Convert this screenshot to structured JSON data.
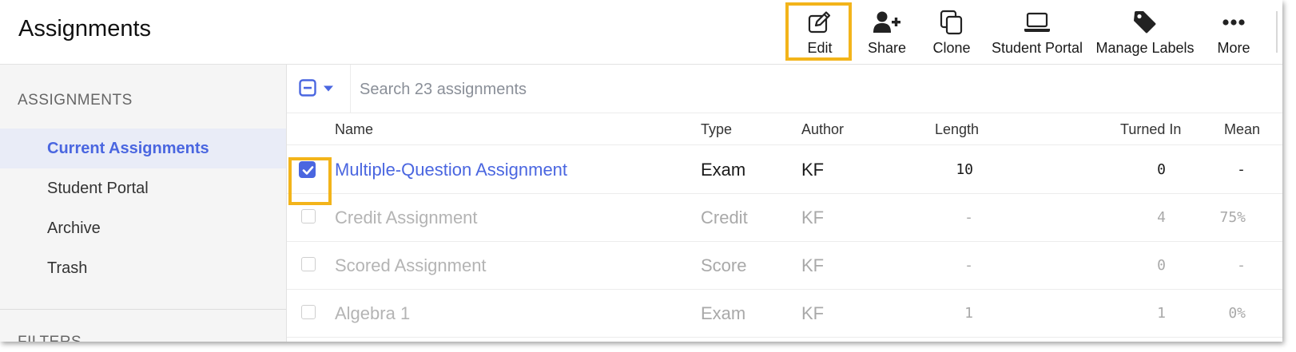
{
  "header": {
    "title": "Assignments",
    "toolbar": [
      {
        "id": "edit",
        "label": "Edit",
        "icon": "edit-icon"
      },
      {
        "id": "share",
        "label": "Share",
        "icon": "user-plus-icon"
      },
      {
        "id": "clone",
        "label": "Clone",
        "icon": "copy-icon"
      },
      {
        "id": "student_portal",
        "label": "Student Portal",
        "icon": "laptop-icon"
      },
      {
        "id": "manage_labels",
        "label": "Manage Labels",
        "icon": "tag-icon"
      },
      {
        "id": "more",
        "label": "More",
        "icon": "ellipsis-icon"
      }
    ]
  },
  "sidebar": {
    "section_title": "ASSIGNMENTS",
    "items": [
      {
        "label": "Current Assignments",
        "active": true
      },
      {
        "label": "Student Portal"
      },
      {
        "label": "Archive"
      },
      {
        "label": "Trash"
      }
    ],
    "section2_title": "FILTERS"
  },
  "search": {
    "placeholder": "Search 23 assignments"
  },
  "table": {
    "columns": {
      "name": "Name",
      "type": "Type",
      "author": "Author",
      "length": "Length",
      "turned_in": "Turned In",
      "mean": "Mean"
    },
    "rows": [
      {
        "name": "Multiple-Question Assignment",
        "type": "Exam",
        "author": "KF",
        "length": "10",
        "turned_in": "0",
        "mean": "-",
        "checked": true
      },
      {
        "name": "Credit Assignment",
        "type": "Credit",
        "author": "KF",
        "length": "-",
        "turned_in": "4",
        "mean": "75%",
        "checked": false
      },
      {
        "name": "Scored Assignment",
        "type": "Score",
        "author": "KF",
        "length": "-",
        "turned_in": "0",
        "mean": "-",
        "checked": false
      },
      {
        "name": "Algebra 1",
        "type": "Exam",
        "author": "KF",
        "length": "1",
        "turned_in": "1",
        "mean": "0%",
        "checked": false
      }
    ]
  },
  "colors": {
    "accent": "#4a66e0",
    "highlight": "#f3b41a"
  }
}
